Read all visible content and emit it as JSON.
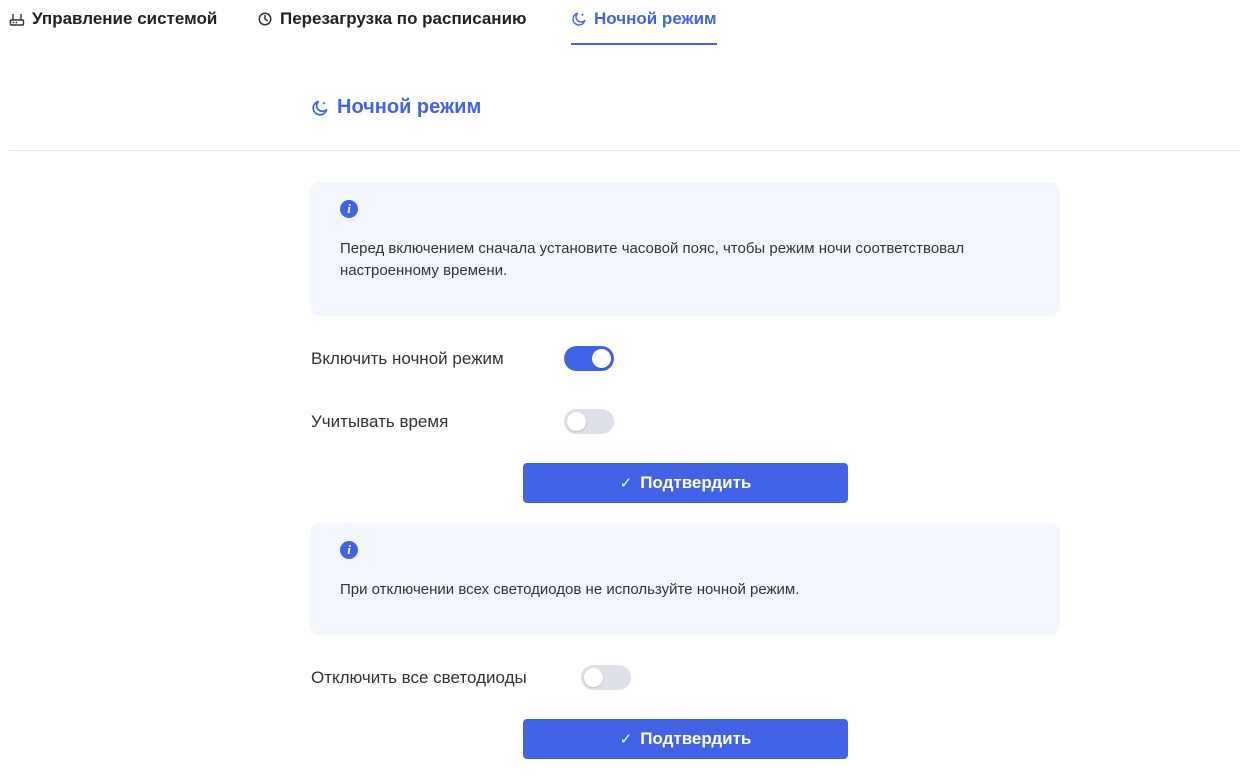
{
  "tabs": [
    {
      "label": "Управление системой",
      "icon": "router-icon",
      "active": false
    },
    {
      "label": "Перезагрузка по расписанию",
      "icon": "clock-icon",
      "active": false
    },
    {
      "label": "Ночной режим",
      "icon": "moon-icon",
      "active": true
    }
  ],
  "section": {
    "title": "Ночной режим",
    "icon": "moon-icon"
  },
  "info1": {
    "icon": "info-icon",
    "text": "Перед включением сначала установите часовой пояс, чтобы режим ночи соответствовал настроенному времени."
  },
  "settings": {
    "night_mode": {
      "label": "Включить ночной режим",
      "enabled": true
    },
    "consider_time": {
      "label": "Учитывать время",
      "enabled": false
    }
  },
  "confirm1": {
    "label": "Подтвердить",
    "icon": "check-icon"
  },
  "info2": {
    "icon": "info-icon",
    "text": "При отключении всех светодиодов не используйте ночной режим."
  },
  "leds": {
    "label": "Отключить все светодиоды",
    "enabled": false
  },
  "confirm2": {
    "label": "Подтвердить",
    "icon": "check-icon"
  },
  "colors": {
    "accent": "#4263e6",
    "info_bg": "#f3f7fd",
    "toggle_off": "#dde0e6"
  }
}
